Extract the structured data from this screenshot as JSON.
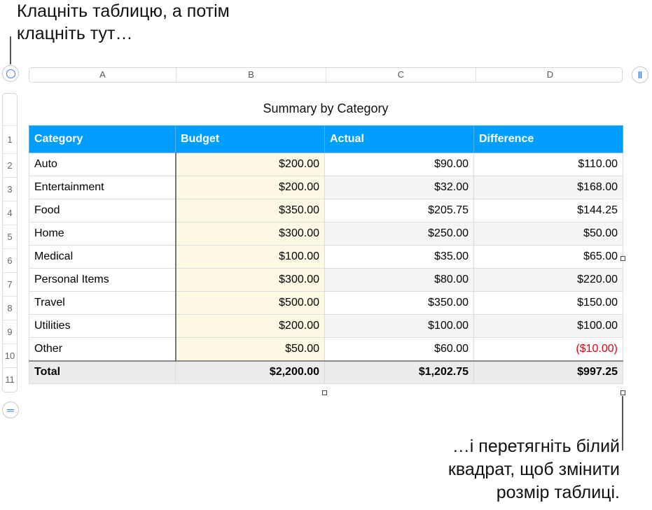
{
  "callouts": {
    "top": [
      "Клацніть таблицю, а потім",
      "клацніть тут…"
    ],
    "bottom": [
      "…і перетягніть білий",
      "квадрат, щоб змінити",
      "розмір таблиці."
    ]
  },
  "columns": [
    "A",
    "B",
    "C",
    "D"
  ],
  "rows": [
    "1",
    "2",
    "3",
    "4",
    "5",
    "6",
    "7",
    "8",
    "9",
    "10",
    "11"
  ],
  "table": {
    "title": "Summary by Category",
    "headers": [
      "Category",
      "Budget",
      "Actual",
      "Difference"
    ],
    "body": [
      [
        "Auto",
        "$200.00",
        "$90.00",
        "$110.00"
      ],
      [
        "Entertainment",
        "$200.00",
        "$32.00",
        "$168.00"
      ],
      [
        "Food",
        "$350.00",
        "$205.75",
        "$144.25"
      ],
      [
        "Home",
        "$300.00",
        "$250.00",
        "$50.00"
      ],
      [
        "Medical",
        "$100.00",
        "$35.00",
        "$65.00"
      ],
      [
        "Personal Items",
        "$300.00",
        "$80.00",
        "$220.00"
      ],
      [
        "Travel",
        "$500.00",
        "$350.00",
        "$150.00"
      ],
      [
        "Utilities",
        "$200.00",
        "$100.00",
        "$100.00"
      ],
      [
        "Other",
        "$50.00",
        "$60.00",
        "($10.00)"
      ]
    ],
    "total": [
      "Total",
      "$2,200.00",
      "$1,202.75",
      "$997.25"
    ]
  },
  "colors": {
    "header": "#009ffd",
    "budget_bg": "#fdf8e3",
    "negative": "#e3000f"
  }
}
